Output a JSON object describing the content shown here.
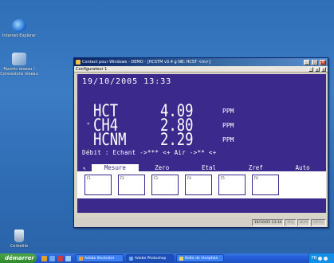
{
  "desktop": {
    "icons": [
      {
        "label": "Internet Explorer"
      },
      {
        "label": "Favoris réseau / Connexions réseau"
      },
      {
        "label": "Corbeille"
      }
    ]
  },
  "window": {
    "title": "Contact pour Windows - DEMO - [HCSTM v3.4 g NB: HCST <m>]",
    "mdi_title": "Configurateur 1",
    "screen": {
      "datetime": "19/10/2005  13:33",
      "measures": [
        {
          "name": "HCT",
          "value": "4.09",
          "unit": "PPM",
          "selected": false
        },
        {
          "name": "CH4",
          "value": "2.80",
          "unit": "PPM",
          "selected": true
        },
        {
          "name": "HCNM",
          "value": "2.29",
          "unit": "PPM",
          "selected": false
        }
      ],
      "selection_marker": "*",
      "status_line": "Débit : Echant ->*** <+ Air ->** <+"
    },
    "softkeys": [
      {
        "label": "↖",
        "active": false
      },
      {
        "label": "Mesure",
        "active": true
      },
      {
        "label": "Zero",
        "active": false
      },
      {
        "label": "Etal",
        "active": false
      },
      {
        "label": "Zref",
        "active": false
      },
      {
        "label": "Auto",
        "active": false
      }
    ],
    "fkeys": [
      "F1",
      "F2",
      "F3",
      "F4",
      "F5",
      "F6"
    ],
    "statusbar": {
      "datetime": "19/10/05 13:34",
      "cap": "MAJ",
      "num": "NUM",
      "scrl": "DEFIL"
    }
  },
  "taskbar": {
    "start": "démarrer",
    "tasks": [
      {
        "label": "Adobe Illustrator",
        "icon_color": "#f0a030"
      },
      {
        "label": "Adobe Photoshop",
        "icon_color": "#6aa9ef"
      },
      {
        "label": "Boîte de réception",
        "icon_color": "#f0d060"
      }
    ],
    "tray_text": "FR"
  }
}
